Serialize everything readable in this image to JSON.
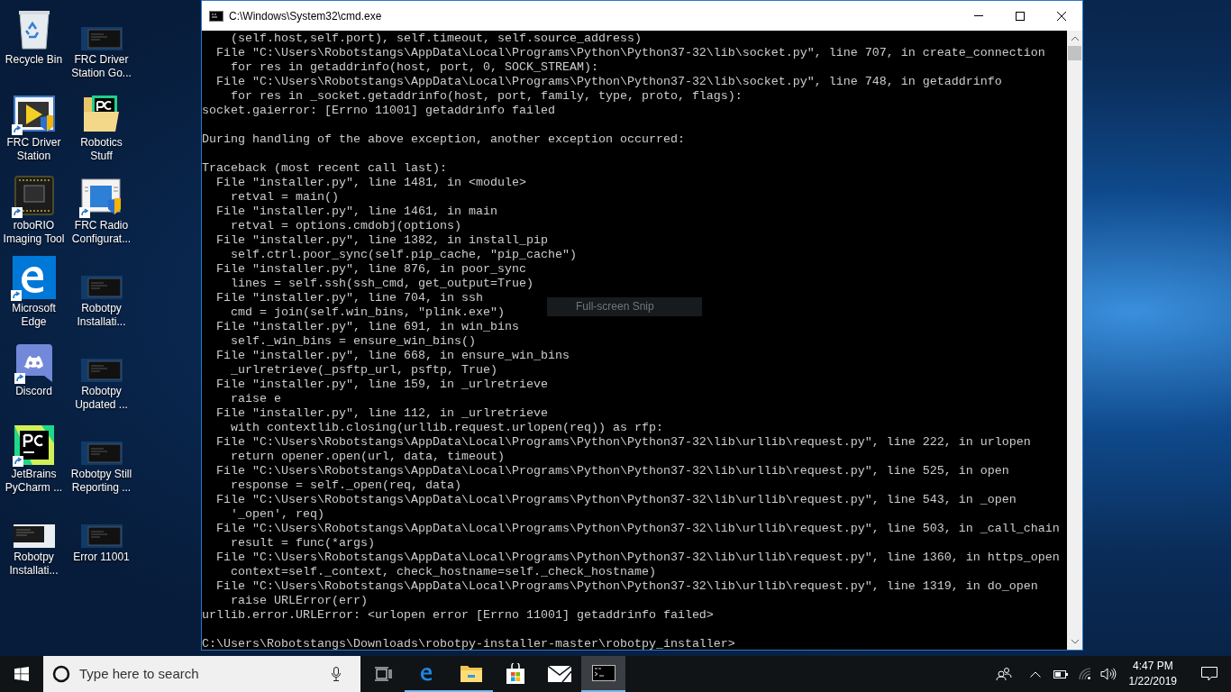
{
  "desktop": {
    "icons": [
      {
        "kind": "recycle-bin",
        "label": "Recycle Bin",
        "shortcut": false
      },
      {
        "kind": "driver-station",
        "label": "FRC Driver Station",
        "shortcut": true
      },
      {
        "kind": "circuit-board",
        "label": "roboRIO Imaging Tool",
        "shortcut": true
      },
      {
        "kind": "edge",
        "label": "Microsoft Edge",
        "shortcut": true
      },
      {
        "kind": "discord",
        "label": "Discord",
        "shortcut": true
      },
      {
        "kind": "pycharm",
        "label": "JetBrains PyCharm ...",
        "shortcut": true
      },
      {
        "kind": "light-thumbnail",
        "label": "Robotpy Installati...",
        "shortcut": false
      },
      {
        "kind": "console-thumbnail",
        "label": "FRC Driver Station Go...",
        "shortcut": false
      },
      {
        "kind": "folder",
        "label": "Robotics Stuff",
        "shortcut": false
      },
      {
        "kind": "radio-config",
        "label": "FRC Radio Configurat...",
        "shortcut": true
      },
      {
        "kind": "console-thumbnail",
        "label": "Robotpy Installati...",
        "shortcut": false
      },
      {
        "kind": "console-thumbnail",
        "label": "Robotpy Updated ...",
        "shortcut": false
      },
      {
        "kind": "console-thumbnail",
        "label": "Robotpy Still Reporting ...",
        "shortcut": false
      },
      {
        "kind": "console-thumbnail",
        "label": "Error 11001",
        "shortcut": false
      }
    ]
  },
  "window": {
    "title": "C:\\Windows\\System32\\cmd.exe",
    "console_blocks": [
      [
        "    (self.host,self.port), self.timeout, self.source_address)",
        "  File \"C:\\Users\\Robotstangs\\AppData\\Local\\Programs\\Python\\Python37-32\\lib\\socket.py\", line 707, in create_connection",
        "    for res in getaddrinfo(host, port, 0, SOCK_STREAM):",
        "  File \"C:\\Users\\Robotstangs\\AppData\\Local\\Programs\\Python\\Python37-32\\lib\\socket.py\", line 748, in getaddrinfo",
        "    for res in _socket.getaddrinfo(host, port, family, type, proto, flags):",
        "socket.gaierror: [Errno 11001] getaddrinfo failed"
      ],
      [
        "During handling of the above exception, another exception occurred:"
      ],
      [
        "Traceback (most recent call last):",
        "  File \"installer.py\", line 1481, in <module>",
        "    retval = main()",
        "  File \"installer.py\", line 1461, in main",
        "    retval = options.cmdobj(options)",
        "  File \"installer.py\", line 1382, in install_pip",
        "    self.ctrl.poor_sync(self.pip_cache, \"pip_cache\")",
        "  File \"installer.py\", line 876, in poor_sync",
        "    lines = self.ssh(ssh_cmd, get_output=True)",
        "  File \"installer.py\", line 704, in ssh",
        "    cmd = join(self.win_bins, \"plink.exe\")",
        "  File \"installer.py\", line 691, in win_bins",
        "    self._win_bins = ensure_win_bins()",
        "  File \"installer.py\", line 668, in ensure_win_bins",
        "    _urlretrieve(_psftp_url, psftp, True)",
        "  File \"installer.py\", line 159, in _urlretrieve",
        "    raise e",
        "  File \"installer.py\", line 112, in _urlretrieve",
        "    with contextlib.closing(urllib.request.urlopen(req)) as rfp:",
        "  File \"C:\\Users\\Robotstangs\\AppData\\Local\\Programs\\Python\\Python37-32\\lib\\urllib\\request.py\", line 222, in urlopen",
        "    return opener.open(url, data, timeout)",
        "  File \"C:\\Users\\Robotstangs\\AppData\\Local\\Programs\\Python\\Python37-32\\lib\\urllib\\request.py\", line 525, in open",
        "    response = self._open(req, data)",
        "  File \"C:\\Users\\Robotstangs\\AppData\\Local\\Programs\\Python\\Python37-32\\lib\\urllib\\request.py\", line 543, in _open",
        "    '_open', req)",
        "  File \"C:\\Users\\Robotstangs\\AppData\\Local\\Programs\\Python\\Python37-32\\lib\\urllib\\request.py\", line 503, in _call_chain",
        "    result = func(*args)",
        "  File \"C:\\Users\\Robotstangs\\AppData\\Local\\Programs\\Python\\Python37-32\\lib\\urllib\\request.py\", line 1360, in https_open",
        "    context=self._context, check_hostname=self._check_hostname)",
        "  File \"C:\\Users\\Robotstangs\\AppData\\Local\\Programs\\Python\\Python37-32\\lib\\urllib\\request.py\", line 1319, in do_open",
        "    raise URLError(err)",
        "urllib.error.URLError: <urlopen error [Errno 11001] getaddrinfo failed>"
      ],
      [
        "C:\\Users\\Robotstangs\\Downloads\\robotpy-installer-master\\robotpy_installer>"
      ]
    ]
  },
  "tooltip": {
    "text": "Full-screen Snip"
  },
  "taskbar": {
    "search": {
      "placeholder": "Type here to search"
    },
    "apps": [
      {
        "kind": "task-view",
        "running": false,
        "active": false
      },
      {
        "kind": "edge",
        "running": true,
        "active": false
      },
      {
        "kind": "explorer",
        "running": true,
        "active": false
      },
      {
        "kind": "store",
        "running": false,
        "active": false
      },
      {
        "kind": "mail",
        "running": false,
        "active": false
      },
      {
        "kind": "console",
        "running": true,
        "active": true
      }
    ],
    "clock": {
      "time": "4:47 PM",
      "date": "1/22/2019"
    }
  }
}
